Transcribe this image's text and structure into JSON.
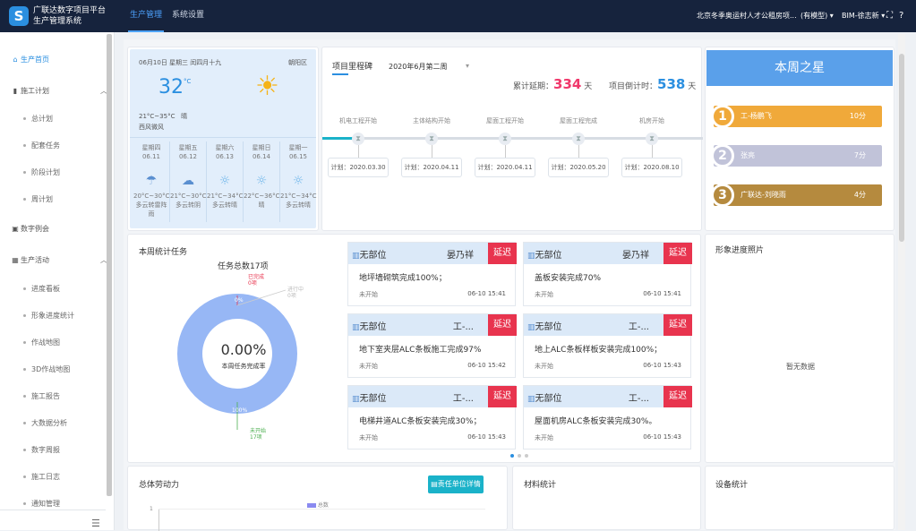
{
  "app": {
    "title_line1": "广联达数字项目平台",
    "title_line2": "生产管理系统",
    "logo_letter": "S"
  },
  "topnav": {
    "items": [
      "生产管理",
      "系统设置"
    ]
  },
  "topright": {
    "project": "北京冬季奥运村人才公租房项...",
    "mode": "(有模型)",
    "user": "BIM-徐志新"
  },
  "sidebar": {
    "home": "生产首页",
    "plan": "施工计划",
    "plan_items": [
      "总计划",
      "配套任务",
      "阶段计划",
      "周计划"
    ],
    "meeting": "数字例会",
    "activity": "生产活动",
    "activity_items": [
      "进度看板",
      "形象进度统计",
      "作战地图",
      "3D作战地图",
      "施工报告",
      "大数据分析",
      "数字周报",
      "施工日志",
      "通知管理"
    ]
  },
  "weather": {
    "date": "06月10日 星期三 闰四月十九",
    "district": "朝阳区",
    "temp": "32",
    "unit": "°C",
    "range": "21°C~35°C",
    "condition": "晴",
    "wind": "西风微风",
    "forecast": [
      {
        "day": "星期四",
        "date": "06.11",
        "range": "20°C~30°C",
        "desc": "多云转雷阵雨",
        "icon": "cloud-rain-icon"
      },
      {
        "day": "星期五",
        "date": "06.12",
        "range": "21°C~30°C",
        "desc": "多云转阴",
        "icon": "cloud-icon"
      },
      {
        "day": "星期六",
        "date": "06.13",
        "range": "21°C~34°C",
        "desc": "多云转晴",
        "icon": "sun-icon"
      },
      {
        "day": "星期日",
        "date": "06.14",
        "range": "22°C~36°C",
        "desc": "晴",
        "icon": "sun-icon"
      },
      {
        "day": "星期一",
        "date": "06.15",
        "range": "21°C~34°C",
        "desc": "多云转晴",
        "icon": "sun-icon"
      }
    ]
  },
  "milestones": {
    "title": "项目里程碑",
    "week": "2020年6月第二周",
    "delay_label": "累计延期：",
    "delay_value": "334",
    "delay_unit": "天",
    "countdown_label": "项目倒计时：",
    "countdown_value": "538",
    "countdown_unit": "天",
    "items": [
      {
        "name": "机电工程开始",
        "plan": "计划：2020.03.30"
      },
      {
        "name": "主体结构开始",
        "plan": "计划：2020.04.11"
      },
      {
        "name": "屋面工程开始",
        "plan": "计划：2020.04.11"
      },
      {
        "name": "屋面工程完成",
        "plan": "计划：2020.05.20"
      },
      {
        "name": "机房开始",
        "plan": "计划：2020.08.10"
      }
    ]
  },
  "stars": {
    "title": "本周之星",
    "items": [
      {
        "rank": "1",
        "name": "工-杨鹏飞",
        "score": "10分",
        "color": "#f0a93a"
      },
      {
        "rank": "2",
        "name": "张亮",
        "score": "7分",
        "color": "#c1c3d9"
      },
      {
        "rank": "3",
        "name": "广联达-刘晓雨",
        "score": "4分",
        "color": "#b58a3e"
      }
    ]
  },
  "weekly": {
    "title": "本周统计任务",
    "total": "任务总数17项",
    "percent": "0.00%",
    "percent_label": "本周任务完成率",
    "label_done": "已完成",
    "label_done_count": "0项",
    "label_top_pct": "0%",
    "label_right": "进行中",
    "label_right_count": "0项",
    "label_100": "100%",
    "label_notstart": "未开始",
    "label_notstart_count": "17项",
    "complete_fraction": 0
  },
  "tasks": [
    {
      "dept": "无部位",
      "name": "晏乃祥",
      "badge": "延迟",
      "desc": "地坪墙砌筑完成100%；",
      "status": "未开始",
      "date": "06-10 15:41"
    },
    {
      "dept": "无部位",
      "name": "晏乃祥",
      "badge": "延迟",
      "desc": "盖板安装完成70%",
      "status": "未开始",
      "date": "06-10 15:41"
    },
    {
      "dept": "无部位",
      "name": "工-...",
      "badge": "延迟",
      "desc": "地下室夹层ALC条板施工完成97%",
      "status": "未开始",
      "date": "06-10 15:42"
    },
    {
      "dept": "无部位",
      "name": "工-...",
      "badge": "延迟",
      "desc": "地上ALC条板样板安装完成100%；",
      "status": "未开始",
      "date": "06-10 15:43"
    },
    {
      "dept": "无部位",
      "name": "工-...",
      "badge": "延迟",
      "desc": "电梯井道ALC条板安装完成30%；",
      "status": "未开始",
      "date": "06-10 15:43"
    },
    {
      "dept": "无部位",
      "name": "工-...",
      "badge": "延迟",
      "desc": "屋面机房ALC条板安装完成30%。",
      "status": "未开始",
      "date": "06-10 15:43"
    }
  ],
  "photos": {
    "title": "形象进度照片",
    "empty": "暂无数据"
  },
  "labor": {
    "title": "总体劳动力",
    "button": "责任单位详情",
    "legend": "总数",
    "ytick": "1"
  },
  "material": {
    "title": "材料统计"
  },
  "equipment": {
    "title": "设备统计"
  },
  "colors": {
    "primary": "#2b8fe0",
    "topbar": "#16233d",
    "delay": "#e8344e",
    "donut": "#97b7f5",
    "pink": "#f0386b",
    "teal": "#1ab2c9"
  }
}
